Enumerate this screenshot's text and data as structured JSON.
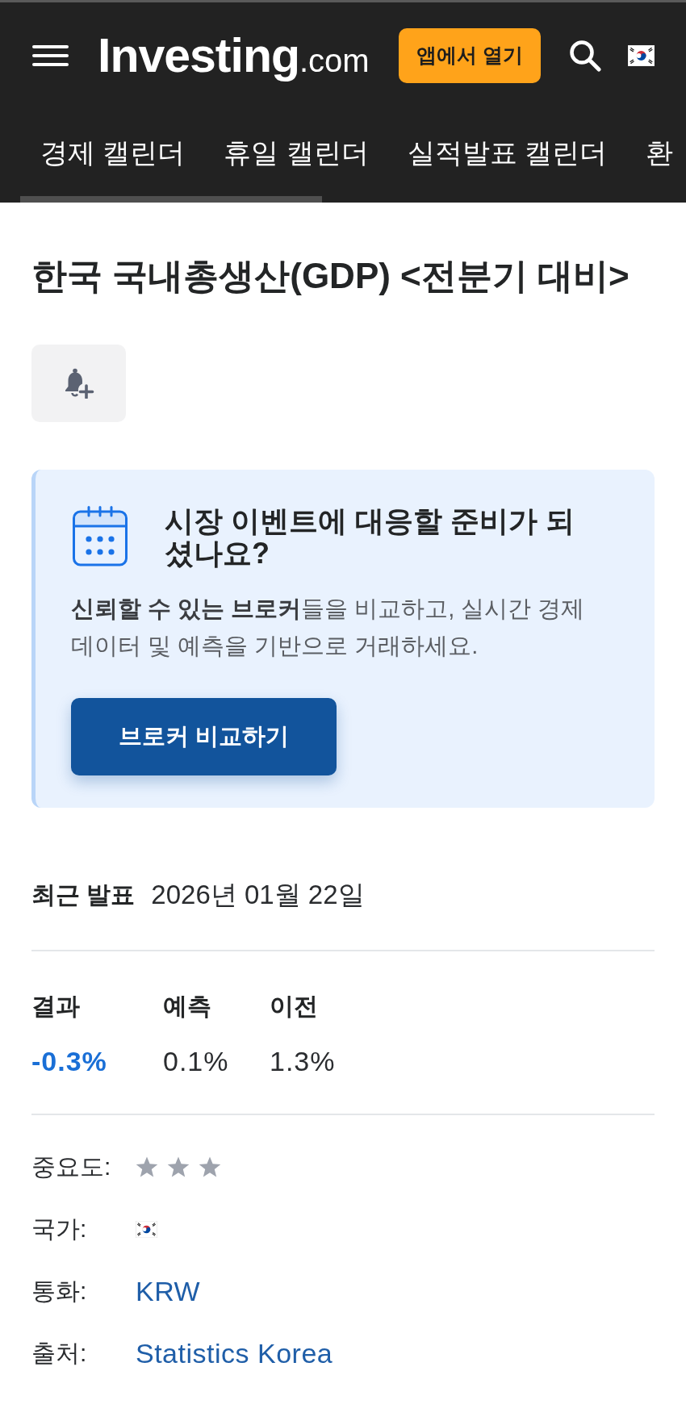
{
  "header": {
    "logo": {
      "name": "Investing",
      "suffix": ".com"
    },
    "open_app_button": "앱에서 열기"
  },
  "nav_tabs": [
    {
      "label": "경제 캘린더"
    },
    {
      "label": "휴일 캘린더"
    },
    {
      "label": "실적발표 캘린더"
    },
    {
      "label": "환"
    }
  ],
  "title": "한국 국내총생산(GDP) <전분기 대비>",
  "promo": {
    "heading": "시장 이벤트에 대응할 준비가 되셨나요?",
    "body": "**신뢰할 수 있는 브로커**들을 비교하고, 실시간 경제 데이터 및 예측을 기반으로 거래하세요.",
    "button": "브로커 비교하기"
  },
  "latest_release": {
    "label": "최근 발표",
    "date": "2026년 01월 22일"
  },
  "figures": [
    {
      "label": "결과",
      "value": "-0.3%",
      "kind": "actual"
    },
    {
      "label": "예측",
      "value": "0.1%",
      "kind": "forecast"
    },
    {
      "label": "이전",
      "value": "1.3%",
      "kind": "previous"
    }
  ],
  "details": [
    {
      "label": "중요도:",
      "kind": "stars",
      "stars": 3
    },
    {
      "label": "국가:",
      "kind": "flag"
    },
    {
      "label": "통화:",
      "kind": "link",
      "value": "KRW"
    },
    {
      "label": "출처:",
      "kind": "link",
      "value": "Statistics Korea"
    }
  ]
}
